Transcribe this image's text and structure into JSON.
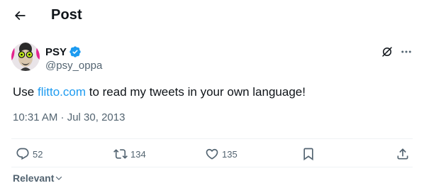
{
  "header": {
    "title": "Post"
  },
  "post": {
    "author": {
      "display_name": "PSY",
      "handle": "@psy_oppa"
    },
    "text_before": "Use ",
    "link_text": "flitto.com",
    "text_after": " to read my tweets in your own language!",
    "timestamp": "10:31 AM · Jul 30, 2013"
  },
  "actions": {
    "replies": "52",
    "reposts": "134",
    "likes": "135"
  },
  "sort": {
    "label": "Relevant"
  },
  "colors": {
    "accent": "#1d9bf0",
    "muted": "#536471",
    "text": "#0f1419",
    "divider": "#eff3f4"
  }
}
